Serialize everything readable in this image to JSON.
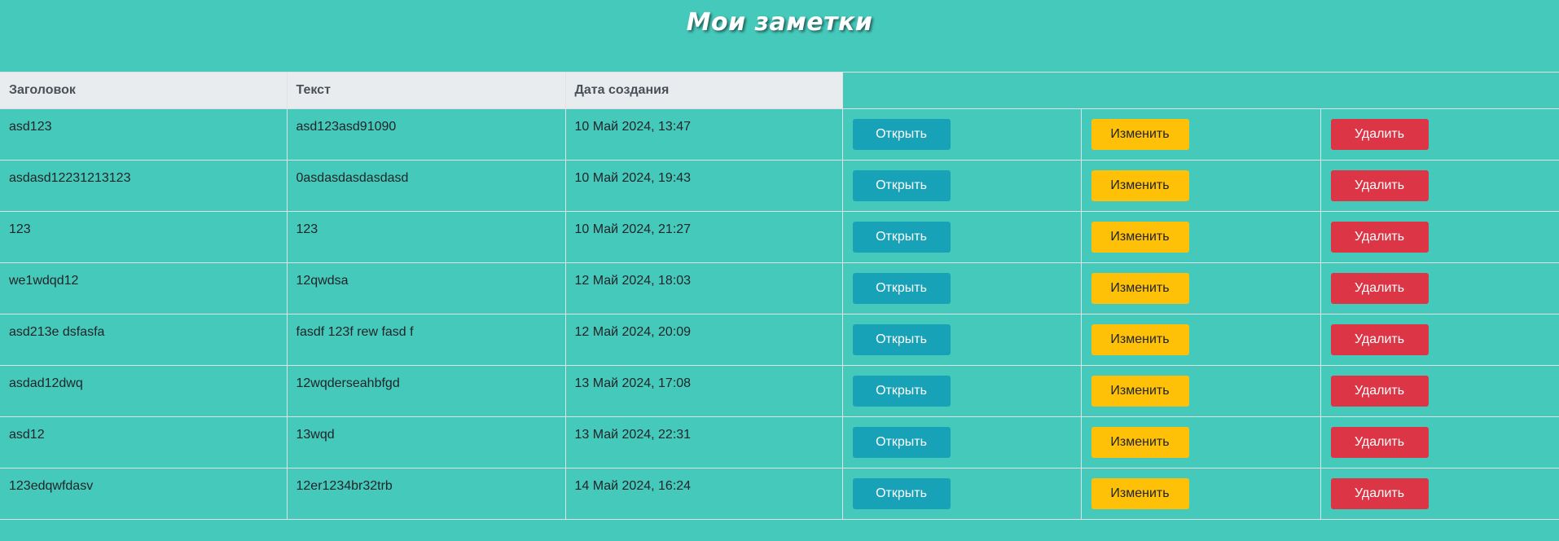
{
  "page": {
    "title": "Мои заметки"
  },
  "table": {
    "headers": [
      "Заголовок",
      "Текст",
      "Дата создания"
    ],
    "actions": {
      "open_label": "Открыть",
      "edit_label": "Изменить",
      "delete_label": "Удалить"
    },
    "rows": [
      {
        "title": "asd123",
        "text": "asd123asd91090",
        "date": "10 Май 2024, 13:47"
      },
      {
        "title": "asdasd12231213123",
        "text": "0asdasdasdasdasd",
        "date": "10 Май 2024, 19:43"
      },
      {
        "title": "123",
        "text": "123",
        "date": "10 Май 2024, 21:27"
      },
      {
        "title": "we1wdqd12",
        "text": "12qwdsa",
        "date": "12 Май 2024, 18:03"
      },
      {
        "title": "asd213e dsfasfa",
        "text": "fasdf 123f rew fasd f",
        "date": "12 Май 2024, 20:09"
      },
      {
        "title": "asdad12dwq",
        "text": "12wqderseahbfgd",
        "date": "13 Май 2024, 17:08"
      },
      {
        "title": "asd12",
        "text": "13wqd",
        "date": "13 Май 2024, 22:31"
      },
      {
        "title": "123edqwfdasv",
        "text": "12er1234br32trb",
        "date": "14 Май 2024, 16:24"
      }
    ]
  },
  "colors": {
    "background": "#45c9bb",
    "header_bg": "#e9ecef",
    "open_button": "#17a2b8",
    "edit_button": "#ffc107",
    "delete_button": "#dc3545"
  }
}
